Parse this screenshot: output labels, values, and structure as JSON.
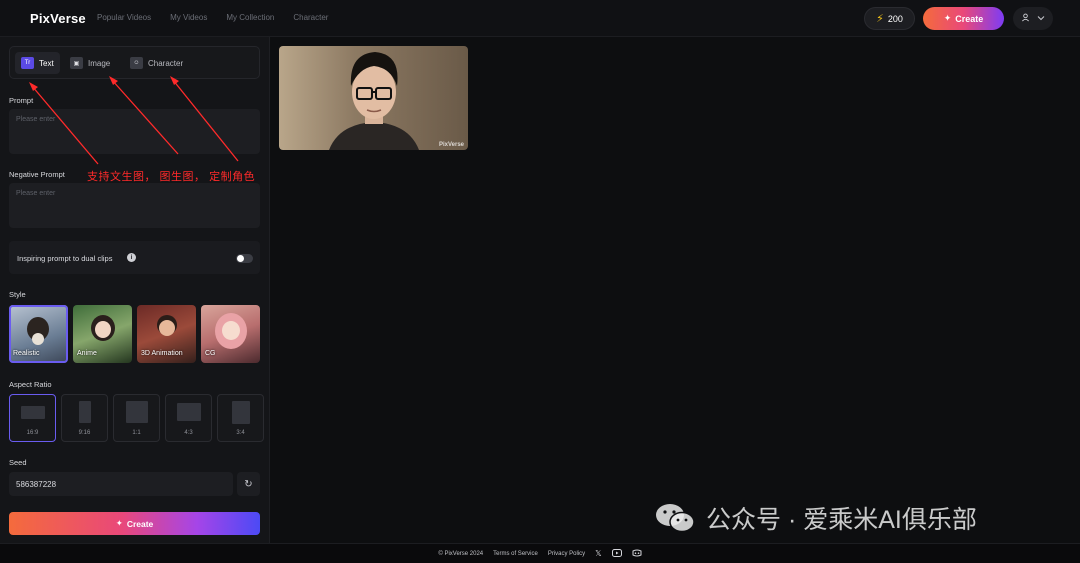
{
  "header": {
    "logo": "PixVerse",
    "nav": [
      "Popular Videos",
      "My Videos",
      "My Collection",
      "Character"
    ],
    "credits": "200",
    "create_label": "Create"
  },
  "tabs": [
    {
      "label": "Text",
      "icon": "text-icon",
      "glyph": "Tr"
    },
    {
      "label": "Image",
      "icon": "image-icon",
      "glyph": "▣"
    },
    {
      "label": "Character",
      "icon": "character-icon",
      "glyph": "☺"
    }
  ],
  "prompt": {
    "label": "Prompt",
    "placeholder": "Please enter"
  },
  "negative_prompt": {
    "label": "Negative Prompt",
    "placeholder": "Please enter"
  },
  "inspiring": {
    "label": "Inspiring prompt to dual clips",
    "enabled": false
  },
  "style": {
    "label": "Style",
    "options": [
      "Realistic",
      "Anime",
      "3D Animation",
      "CG"
    ],
    "selected": "Realistic"
  },
  "aspect_ratio": {
    "label": "Aspect Ratio",
    "options": [
      "16:9",
      "9:16",
      "1:1",
      "4:3",
      "3:4"
    ],
    "selected": "16:9"
  },
  "seed": {
    "label": "Seed",
    "value": "586387228"
  },
  "create_button": "Create",
  "preview": {
    "watermark": "PixVerse"
  },
  "annotation": "支持文生图， 图生图， 定制角色",
  "watermark": "公众号 · 爱乘米AI俱乐部",
  "footer": {
    "copyright": "© PixVerse 2024",
    "terms": "Terms of Service",
    "privacy": "Privacy Policy"
  },
  "colors": {
    "accent": "#6a5cf0",
    "annotation": "#ff2a2a",
    "gradient_start": "#f46b3c",
    "gradient_end": "#4c4af5"
  }
}
